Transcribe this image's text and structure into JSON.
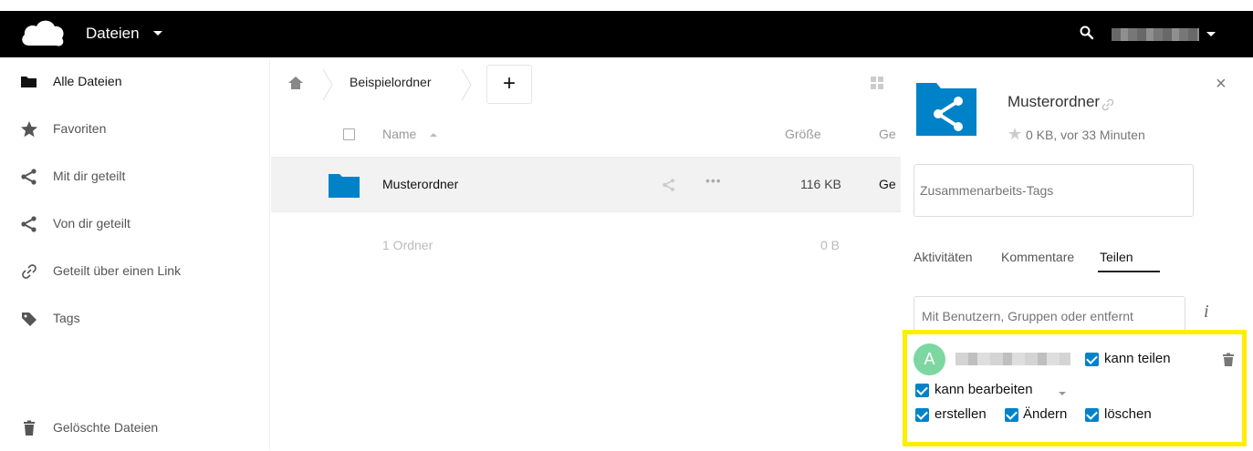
{
  "header": {
    "app_title": "Dateien",
    "user_name": ""
  },
  "sidebar": {
    "items": [
      {
        "label": "Alle Dateien",
        "icon": "folder-icon",
        "active": true
      },
      {
        "label": "Favoriten",
        "icon": "star-icon"
      },
      {
        "label": "Mit dir geteilt",
        "icon": "share-icon"
      },
      {
        "label": "Von dir geteilt",
        "icon": "share-icon"
      },
      {
        "label": "Geteilt über einen Link",
        "icon": "link-icon"
      },
      {
        "label": "Tags",
        "icon": "tag-icon"
      }
    ],
    "trash_label": "Gelöschte Dateien"
  },
  "breadcrumb": {
    "folder": "Beispielordner",
    "new_button": "+"
  },
  "file_list": {
    "columns": {
      "name": "Name",
      "size": "Größe",
      "modified": "Ge"
    },
    "rows": [
      {
        "name": "Musterordner",
        "size": "116 KB",
        "modified": "Ge",
        "more": "•••"
      }
    ],
    "summary": {
      "count": "1 Ordner",
      "size": "0 B"
    }
  },
  "details": {
    "close": "×",
    "title": "Musterordner",
    "meta": "0 KB, vor 33 Minuten",
    "tags_placeholder": "Zusammenarbeits-Tags",
    "tabs": [
      {
        "label": "Aktivitäten"
      },
      {
        "label": "Kommentare"
      },
      {
        "label": "Teilen",
        "active": true
      }
    ],
    "share_placeholder": "Mit Benutzern, Gruppen oder entfernt",
    "info": "i",
    "share_entry": {
      "avatar_letter": "A",
      "user_name": "",
      "can_share": "kann teilen",
      "can_edit": "kann bearbeiten",
      "create": "erstellen",
      "change": "Ändern",
      "delete": "löschen"
    }
  },
  "colors": {
    "accent": "#0082c9",
    "highlight": "#ffee00",
    "avatar": "#7dd7a0"
  }
}
